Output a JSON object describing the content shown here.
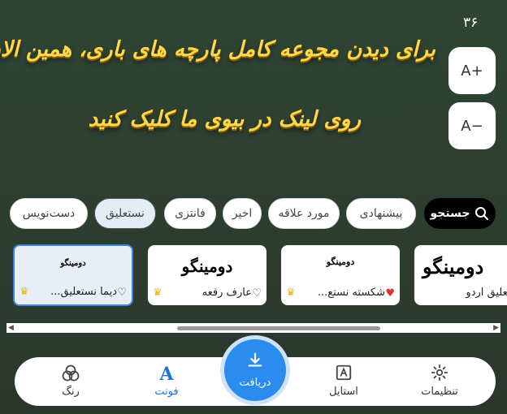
{
  "preview": {
    "counter": "۳۶",
    "line1": "برای دیدن مجوعه کامل پارچه های باری، همین الان",
    "line2": "روی لینک در بیوی ما کلیک کنید"
  },
  "size_buttons": {
    "increase": "A+",
    "decrease": "A−"
  },
  "categories": {
    "search_label": "جستجو",
    "items": [
      {
        "label": "پیشنهادی",
        "active": false
      },
      {
        "label": "مورد علاقه",
        "active": false
      },
      {
        "label": "اخیر",
        "active": false
      },
      {
        "label": "فانتزی",
        "active": false
      },
      {
        "label": "نستعلیق",
        "active": true
      },
      {
        "label": "دست‌نویس",
        "active": false
      }
    ]
  },
  "font_cards": [
    {
      "name": "نستعلیق اردو",
      "sample": "دومینگو",
      "liked": false,
      "premium": false,
      "selected": false
    },
    {
      "name": "شکسته نستع...",
      "sample": "دومینگو",
      "liked": true,
      "premium": true,
      "selected": false
    },
    {
      "name": "عارف رقعه",
      "sample": "دومینگو",
      "liked": false,
      "premium": true,
      "selected": false
    },
    {
      "name": "دیما نستعلیق...",
      "sample": "دومینگو",
      "liked": false,
      "premium": true,
      "selected": true
    }
  ],
  "bottom_nav": {
    "receive_label": "دریافت",
    "items": [
      {
        "label": "تنظیمات",
        "icon": "gear-icon",
        "active": false
      },
      {
        "label": "استایل",
        "icon": "style-icon",
        "active": false
      },
      {
        "label": "فونت",
        "icon": "font-icon",
        "active": true
      },
      {
        "label": "رنگ",
        "icon": "color-circles-icon",
        "active": false
      }
    ]
  },
  "colors": {
    "accent": "#2b8cf0",
    "active_nav": "#1e73d8",
    "preview_text": "#ffd84a",
    "background": "#2d3f31"
  }
}
